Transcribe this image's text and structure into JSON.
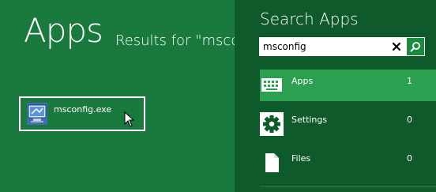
{
  "left": {
    "title": "Apps",
    "results_text": "Results for \"msconfig\"",
    "result": {
      "label": "msconfig.exe",
      "icon": "msconfig-app-icon"
    }
  },
  "panel": {
    "title": "Search Apps",
    "search": {
      "value": "msconfig",
      "clear_icon": "close-icon",
      "search_icon": "search-icon"
    },
    "scopes": [
      {
        "label": "Apps",
        "count": "1",
        "icon": "keyboard-icon",
        "selected": true
      },
      {
        "label": "Settings",
        "count": "0",
        "icon": "gear-icon",
        "selected": false
      },
      {
        "label": "Files",
        "count": "0",
        "icon": "document-icon",
        "selected": false
      }
    ]
  },
  "colors": {
    "background": "#1a7a3e",
    "panel": "#0f5a2b",
    "selected": "#2aa050",
    "search_button": "#1c8a3e"
  }
}
